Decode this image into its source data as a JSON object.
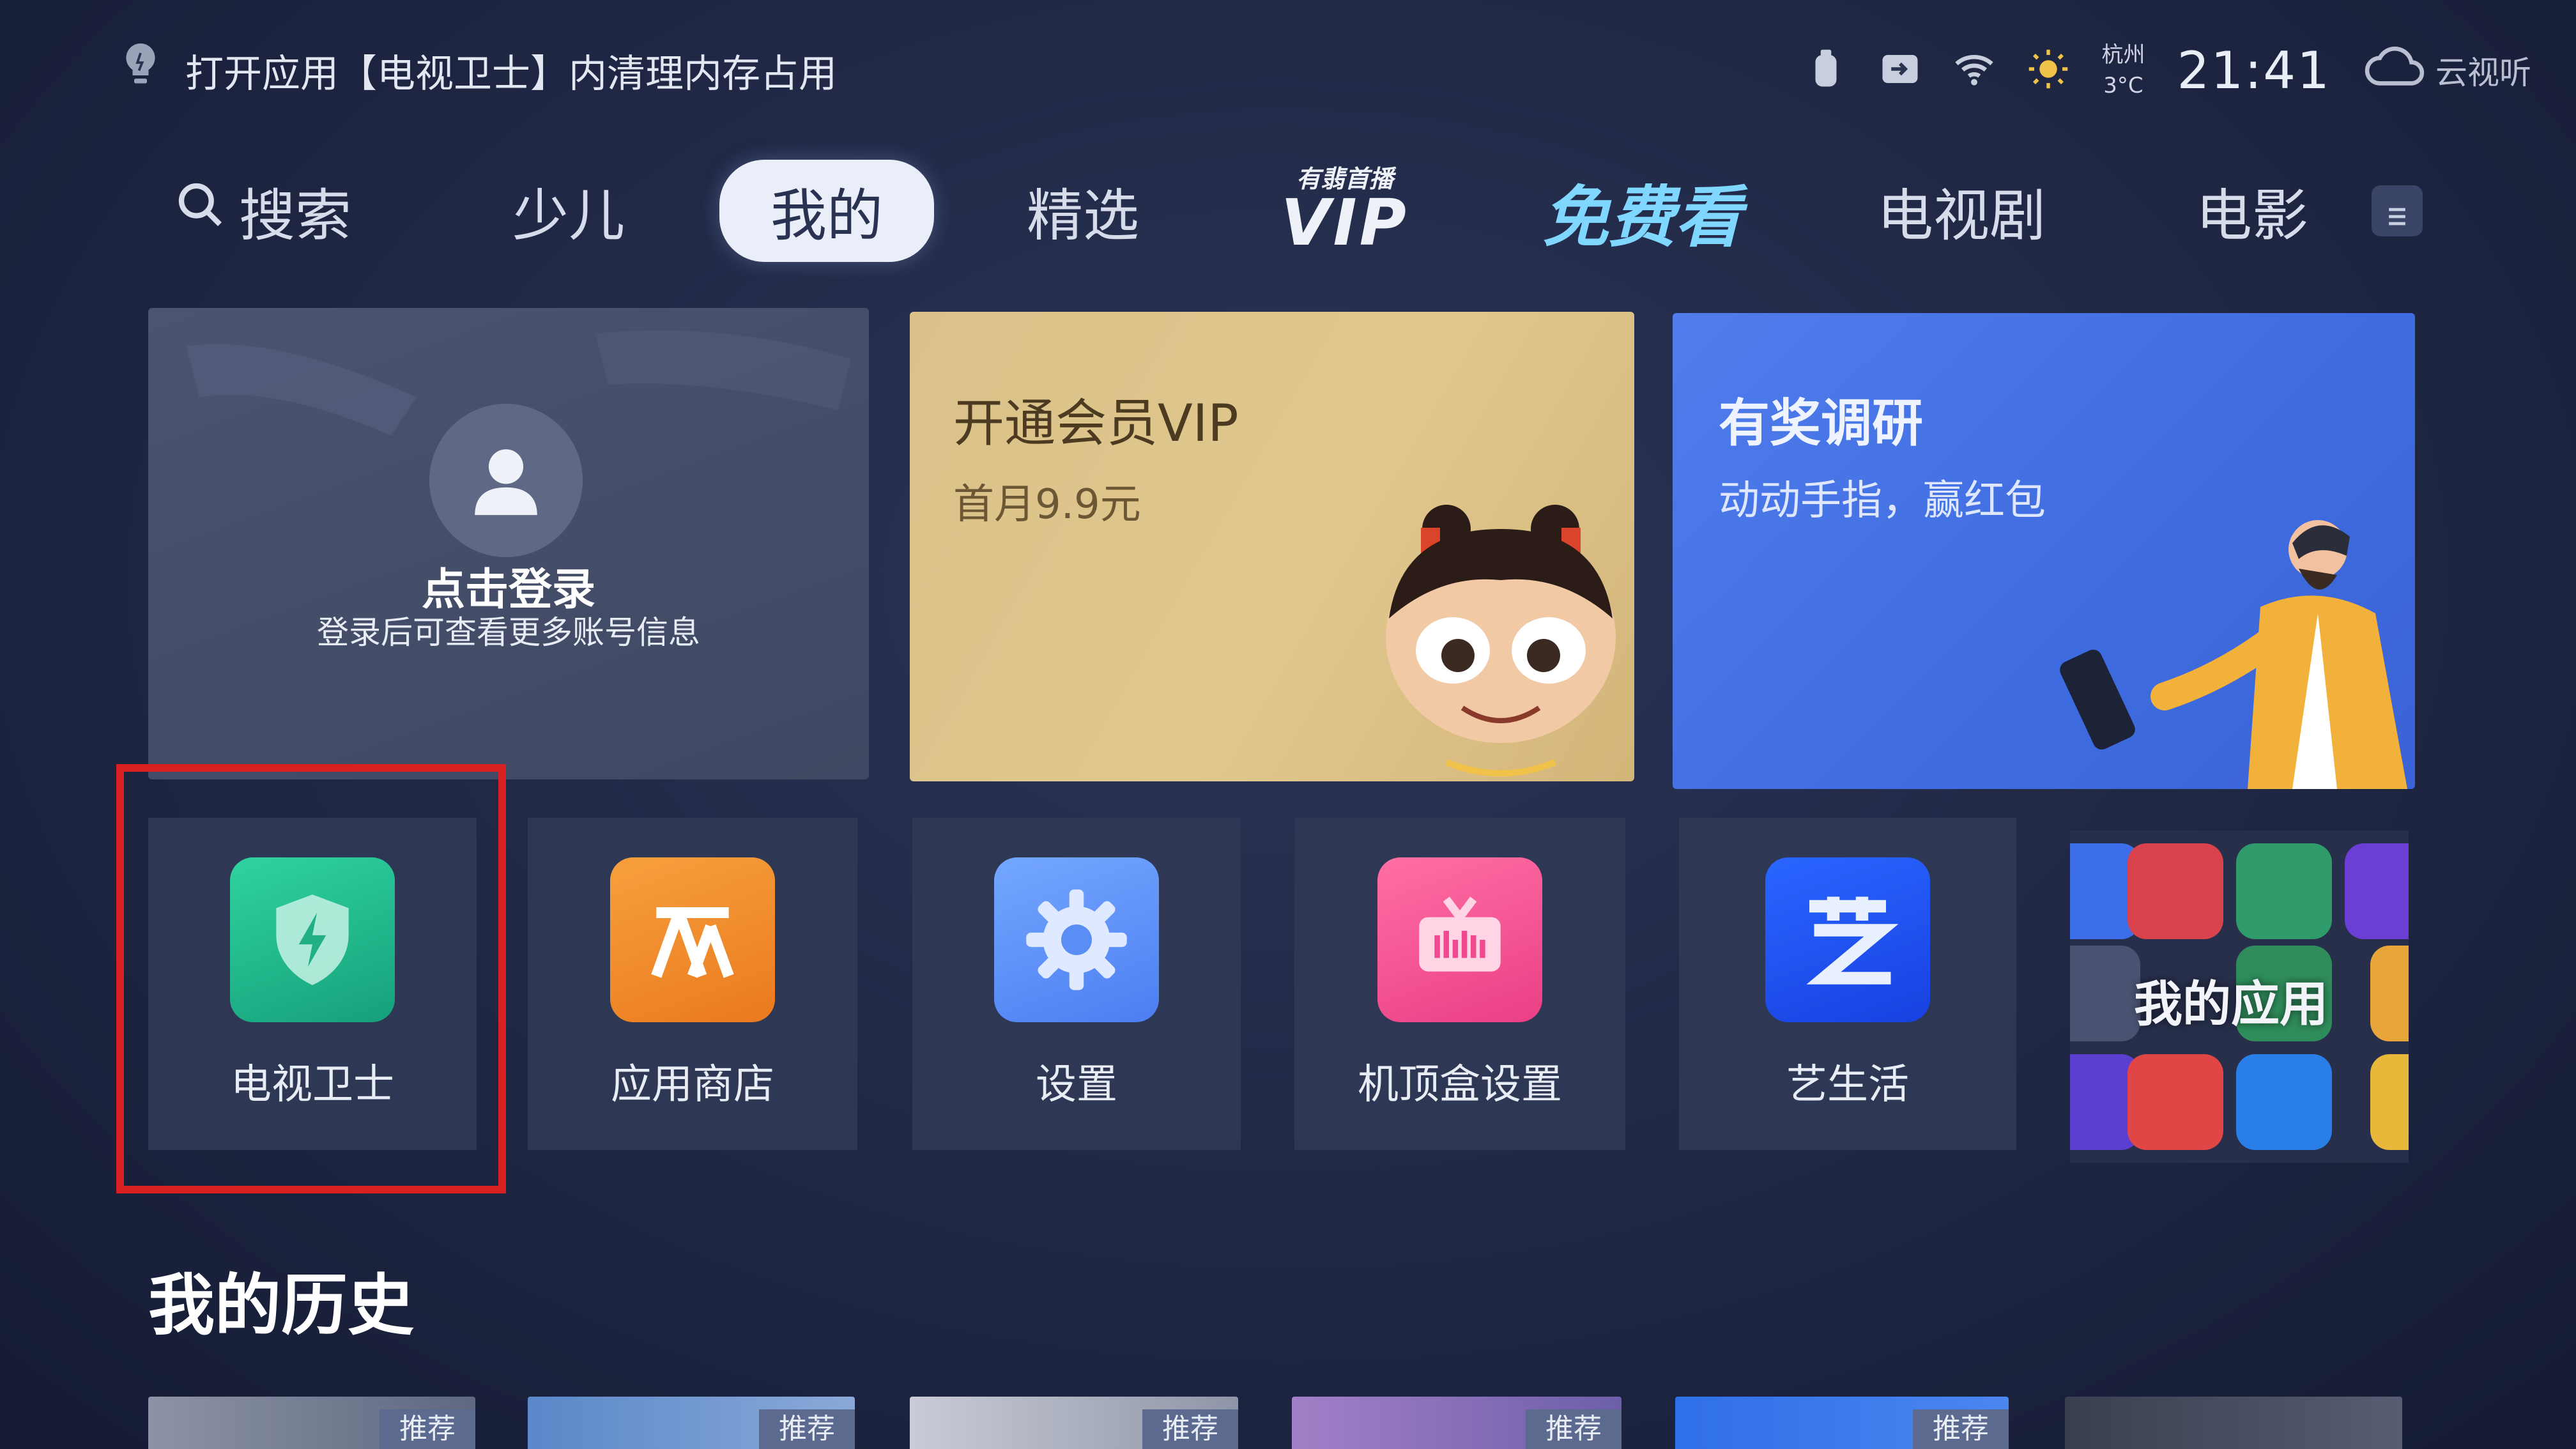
{
  "status_bar": {
    "tip_text": "打开应用【电视卫士】内清理内存占用",
    "city": "杭州",
    "temperature": "3°C",
    "time": "21:41",
    "cloud_label": "云视听"
  },
  "nav": {
    "tabs": [
      {
        "label": "搜索"
      },
      {
        "label": "少儿"
      },
      {
        "label": "我的",
        "active": true
      },
      {
        "label": "精选"
      },
      {
        "label_small": "有翡首播",
        "label": "VIP"
      },
      {
        "label": "免费看"
      },
      {
        "label": "电视剧"
      },
      {
        "label": "电影"
      }
    ],
    "menu_icon": "menu-icon"
  },
  "cards": {
    "login": {
      "title": "点击登录",
      "subtitle": "登录后可查看更多账号信息"
    },
    "vip": {
      "title": "开通会员VIP",
      "subtitle": "首月9.9元"
    },
    "survey": {
      "title": "有奖调研",
      "subtitle": "动动手指，赢红包"
    }
  },
  "apps": [
    {
      "label": "电视卫士",
      "icon": "shield-icon",
      "color": "#22b58a"
    },
    {
      "label": "应用商店",
      "icon": "store-icon",
      "color": "#f08a2a"
    },
    {
      "label": "设置",
      "icon": "gear-icon",
      "color": "#5b8ef5"
    },
    {
      "label": "机顶盒设置",
      "icon": "tv-icon",
      "color": "#f0498f"
    },
    {
      "label": "艺生活",
      "icon": "yi-icon",
      "color": "#1f55ff"
    },
    {
      "label": "我的应用",
      "icon": "apps-grid-icon"
    }
  ],
  "highlight_color": "#d92020",
  "history": {
    "title": "我的历史",
    "badge": "推荐"
  }
}
